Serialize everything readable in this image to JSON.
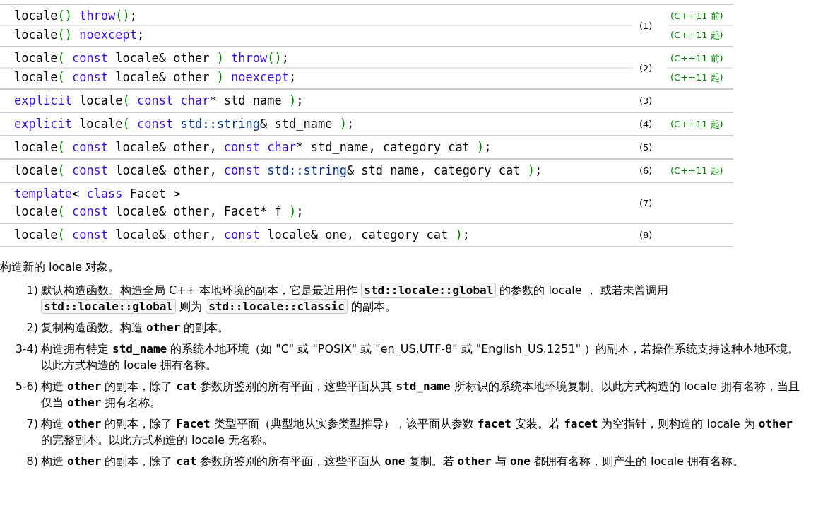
{
  "overloads": [
    {
      "number": "(1)",
      "lines": [
        {
          "version": "(C++11 前)",
          "tokens": [
            {
              "kind": "plain",
              "text": "locale"
            },
            {
              "kind": "paren",
              "text": "()"
            },
            {
              "kind": "keyword",
              "text": " throw"
            },
            {
              "kind": "paren",
              "text": "()"
            },
            {
              "kind": "plain",
              "text": ";"
            }
          ]
        },
        {
          "version": "(C++11 起)",
          "tokens": [
            {
              "kind": "plain",
              "text": "locale"
            },
            {
              "kind": "paren",
              "text": "()"
            },
            {
              "kind": "keyword",
              "text": " noexcept"
            },
            {
              "kind": "plain",
              "text": ";"
            }
          ]
        }
      ]
    },
    {
      "number": "(2)",
      "lines": [
        {
          "version": "(C++11 前)",
          "tokens": [
            {
              "kind": "plain",
              "text": "locale"
            },
            {
              "kind": "paren",
              "text": "("
            },
            {
              "kind": "keyword",
              "text": " const"
            },
            {
              "kind": "plain",
              "text": " locale& other "
            },
            {
              "kind": "paren",
              "text": ")"
            },
            {
              "kind": "keyword",
              "text": " throw"
            },
            {
              "kind": "paren",
              "text": "()"
            },
            {
              "kind": "plain",
              "text": ";"
            }
          ]
        },
        {
          "version": "(C++11 起)",
          "tokens": [
            {
              "kind": "plain",
              "text": "locale"
            },
            {
              "kind": "paren",
              "text": "("
            },
            {
              "kind": "keyword",
              "text": " const"
            },
            {
              "kind": "plain",
              "text": " locale& other "
            },
            {
              "kind": "paren",
              "text": ")"
            },
            {
              "kind": "keyword",
              "text": " noexcept"
            },
            {
              "kind": "plain",
              "text": ";"
            }
          ]
        }
      ]
    },
    {
      "number": "(3)",
      "lines": [
        {
          "tokens": [
            {
              "kind": "keyword",
              "text": "explicit"
            },
            {
              "kind": "plain",
              "text": " locale"
            },
            {
              "kind": "paren",
              "text": "("
            },
            {
              "kind": "keyword",
              "text": " const char"
            },
            {
              "kind": "plain",
              "text": "* std_name "
            },
            {
              "kind": "paren",
              "text": ")"
            },
            {
              "kind": "plain",
              "text": ";"
            }
          ]
        }
      ]
    },
    {
      "number": "(4)",
      "lines": [
        {
          "version": "(C++11 起)",
          "tokens": [
            {
              "kind": "keyword",
              "text": "explicit"
            },
            {
              "kind": "plain",
              "text": " locale"
            },
            {
              "kind": "paren",
              "text": "("
            },
            {
              "kind": "keyword",
              "text": " const"
            },
            {
              "kind": "type",
              "text": " std::string"
            },
            {
              "kind": "plain",
              "text": "& std_name "
            },
            {
              "kind": "paren",
              "text": ")"
            },
            {
              "kind": "plain",
              "text": ";"
            }
          ]
        }
      ]
    },
    {
      "number": "(5)",
      "lines": [
        {
          "tokens": [
            {
              "kind": "plain",
              "text": "locale"
            },
            {
              "kind": "paren",
              "text": "("
            },
            {
              "kind": "keyword",
              "text": " const"
            },
            {
              "kind": "plain",
              "text": " locale& other,"
            },
            {
              "kind": "keyword",
              "text": " const char"
            },
            {
              "kind": "plain",
              "text": "* std_name, category cat "
            },
            {
              "kind": "paren",
              "text": ")"
            },
            {
              "kind": "plain",
              "text": ";"
            }
          ]
        }
      ]
    },
    {
      "number": "(6)",
      "lines": [
        {
          "version": "(C++11 起)",
          "tokens": [
            {
              "kind": "plain",
              "text": "locale"
            },
            {
              "kind": "paren",
              "text": "("
            },
            {
              "kind": "keyword",
              "text": " const"
            },
            {
              "kind": "plain",
              "text": " locale& other,"
            },
            {
              "kind": "keyword",
              "text": " const"
            },
            {
              "kind": "type",
              "text": " std::string"
            },
            {
              "kind": "plain",
              "text": "& std_name, category cat "
            },
            {
              "kind": "paren",
              "text": ")"
            },
            {
              "kind": "plain",
              "text": ";"
            }
          ]
        }
      ]
    },
    {
      "number": "(7)",
      "lines": [
        {
          "tokens": [
            {
              "kind": "keyword",
              "text": "template"
            },
            {
              "kind": "plain",
              "text": "< "
            },
            {
              "kind": "keyword",
              "text": "class"
            },
            {
              "kind": "plain",
              "text": " Facet >"
            }
          ]
        },
        {
          "tokens": [
            {
              "kind": "plain",
              "text": "locale"
            },
            {
              "kind": "paren",
              "text": "("
            },
            {
              "kind": "keyword",
              "text": " const"
            },
            {
              "kind": "plain",
              "text": " locale& other, Facet* f "
            },
            {
              "kind": "paren",
              "text": ")"
            },
            {
              "kind": "plain",
              "text": ";"
            }
          ]
        }
      ]
    },
    {
      "number": "(8)",
      "lines": [
        {
          "tokens": [
            {
              "kind": "plain",
              "text": "locale"
            },
            {
              "kind": "paren",
              "text": "("
            },
            {
              "kind": "keyword",
              "text": " const"
            },
            {
              "kind": "plain",
              "text": " locale& other,"
            },
            {
              "kind": "keyword",
              "text": " const"
            },
            {
              "kind": "plain",
              "text": " locale& one, category cat "
            },
            {
              "kind": "paren",
              "text": ")"
            },
            {
              "kind": "plain",
              "text": ";"
            }
          ]
        }
      ]
    }
  ],
  "intro": "构造新的 locale 对象。",
  "items": [
    {
      "label": "1)",
      "segments": [
        {
          "kind": "text",
          "text": "默认构造函数。构造全局 C++ 本地环境的副本，它是最近用作 "
        },
        {
          "kind": "codebox",
          "text": "std::locale::global"
        },
        {
          "kind": "text",
          "text": " 的参数的 locale ， 或若未曾调用 "
        },
        {
          "kind": "codebox",
          "text": "std::locale::global"
        },
        {
          "kind": "text",
          "text": " 则为 "
        },
        {
          "kind": "codebox",
          "text": "std::locale::classic"
        },
        {
          "kind": "text",
          "text": " 的副本。"
        }
      ]
    },
    {
      "label": "2)",
      "segments": [
        {
          "kind": "text",
          "text": "复制构造函数。构造 "
        },
        {
          "kind": "code",
          "text": "other"
        },
        {
          "kind": "text",
          "text": " 的副本。"
        }
      ]
    },
    {
      "label": "3-4)",
      "segments": [
        {
          "kind": "text",
          "text": "构造拥有特定 "
        },
        {
          "kind": "code",
          "text": "std_name"
        },
        {
          "kind": "text",
          "text": " 的系统本地环境（如 \"C\" 或 \"POSIX\" 或 \"en_US.UTF-8\" 或 \"English_US.1251\" ）的副本，若操作系统支持这种本地环境。以此方式构造的 locale 拥有名称。"
        }
      ]
    },
    {
      "label": "5-6)",
      "segments": [
        {
          "kind": "text",
          "text": "构造 "
        },
        {
          "kind": "code",
          "text": "other"
        },
        {
          "kind": "text",
          "text": " 的副本，除了 "
        },
        {
          "kind": "code",
          "text": "cat"
        },
        {
          "kind": "text",
          "text": " 参数所鉴别的所有平面，这些平面从其 "
        },
        {
          "kind": "code",
          "text": "std_name"
        },
        {
          "kind": "text",
          "text": " 所标识的系统本地环境复制。以此方式构造的 locale 拥有名称，当且仅当 "
        },
        {
          "kind": "code",
          "text": "other"
        },
        {
          "kind": "text",
          "text": " 拥有名称。"
        }
      ]
    },
    {
      "label": "7)",
      "segments": [
        {
          "kind": "text",
          "text": "构造 "
        },
        {
          "kind": "code",
          "text": "other"
        },
        {
          "kind": "text",
          "text": " 的副本，除了 "
        },
        {
          "kind": "code",
          "text": "Facet"
        },
        {
          "kind": "text",
          "text": " 类型平面（典型地从实参类型推导），该平面从参数 "
        },
        {
          "kind": "code",
          "text": "facet"
        },
        {
          "kind": "text",
          "text": " 安装。若 "
        },
        {
          "kind": "code",
          "text": "facet"
        },
        {
          "kind": "text",
          "text": " 为空指针，则构造的 locale 为 "
        },
        {
          "kind": "code",
          "text": "other"
        },
        {
          "kind": "text",
          "text": " 的完整副本。以此方式构造的 locale 无名称。"
        }
      ]
    },
    {
      "label": "8)",
      "segments": [
        {
          "kind": "text",
          "text": "构造 "
        },
        {
          "kind": "code",
          "text": "other"
        },
        {
          "kind": "text",
          "text": " 的副本，除了 "
        },
        {
          "kind": "code",
          "text": "cat"
        },
        {
          "kind": "text",
          "text": " 参数所鉴别的所有平面，这些平面从 "
        },
        {
          "kind": "code",
          "text": "one"
        },
        {
          "kind": "text",
          "text": " 复制。若 "
        },
        {
          "kind": "code",
          "text": "other"
        },
        {
          "kind": "text",
          "text": " 与 "
        },
        {
          "kind": "code",
          "text": "one"
        },
        {
          "kind": "text",
          "text": " 都拥有名称，则产生的 locale 拥有名称。"
        }
      ]
    }
  ]
}
